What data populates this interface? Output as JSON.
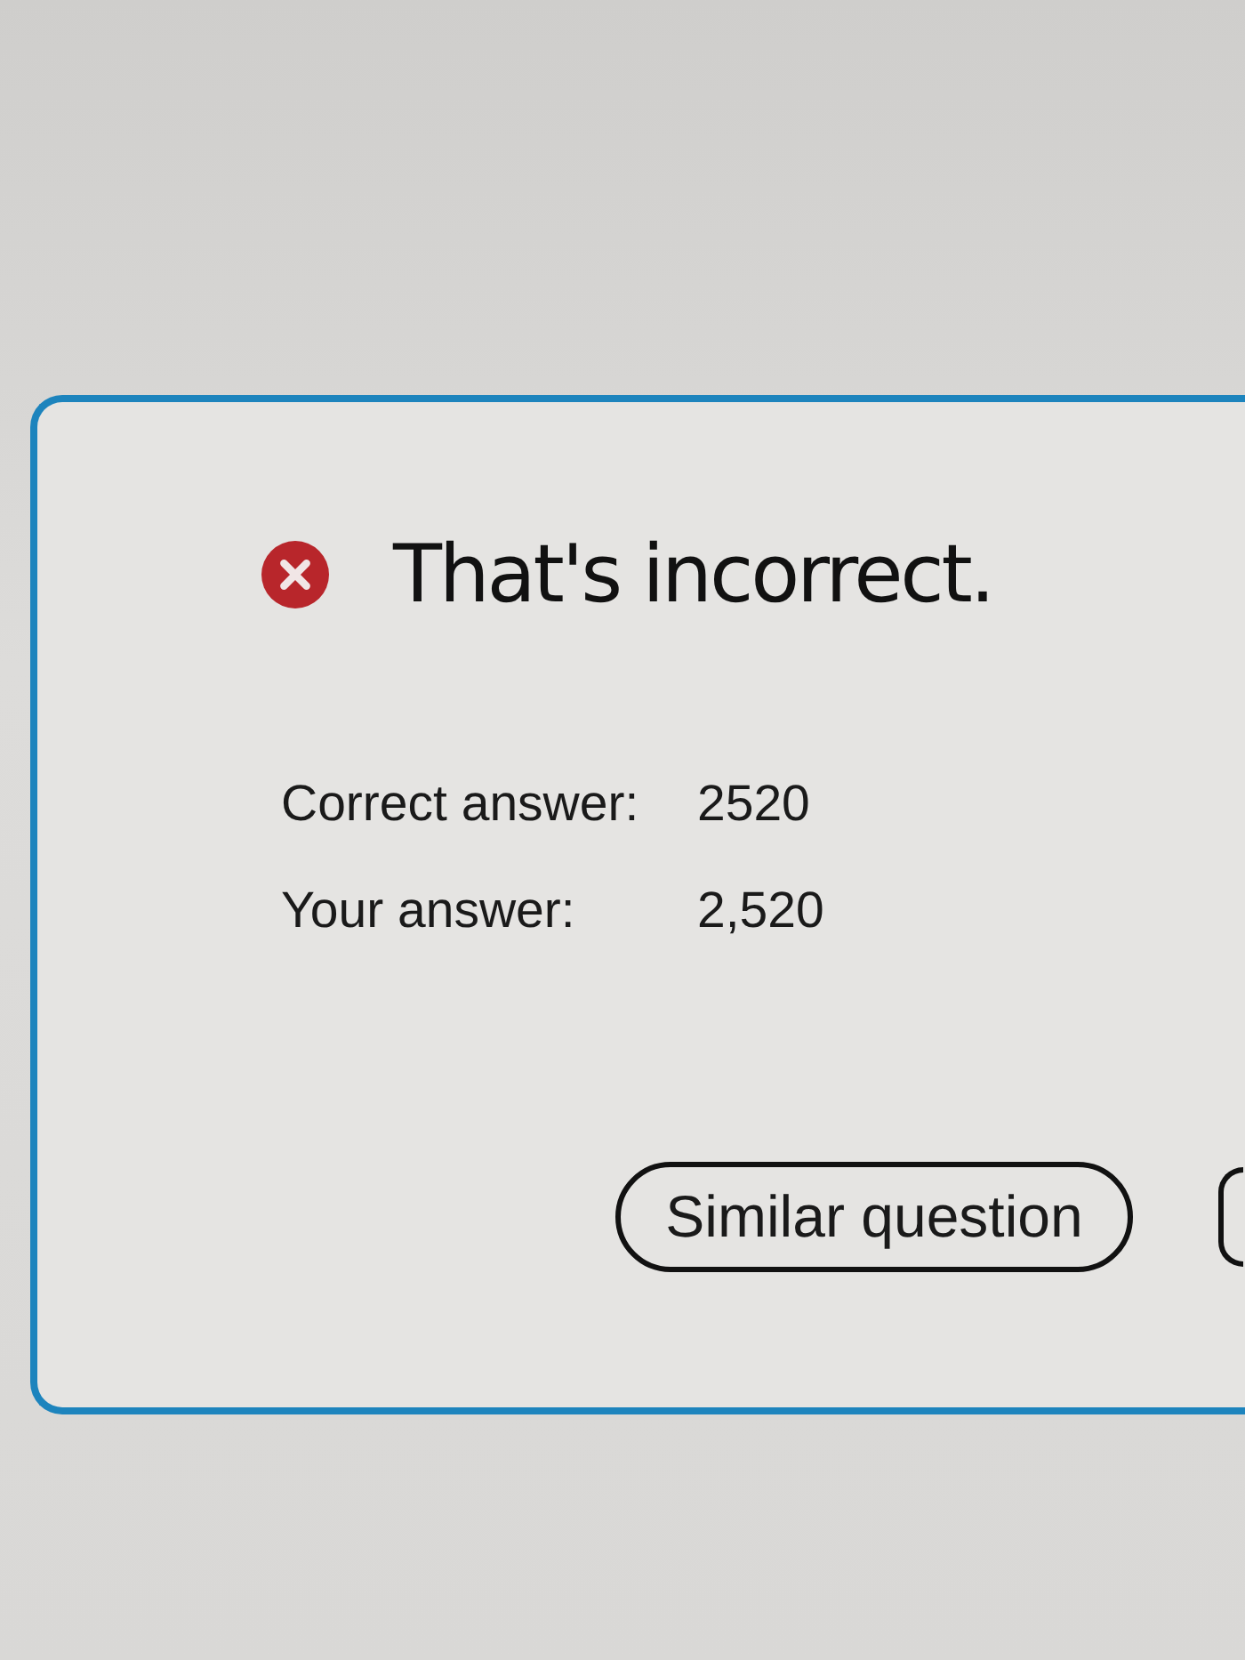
{
  "feedback": {
    "correct": false,
    "title": "That's incorrect."
  },
  "answers": [
    {
      "label": "Correct answer:",
      "value": "2520"
    },
    {
      "label": "Your answer:",
      "value": "2,520"
    }
  ],
  "buttons": [
    {
      "kind": "full",
      "label": "Similar question"
    },
    {
      "kind": "cut"
    }
  ]
}
